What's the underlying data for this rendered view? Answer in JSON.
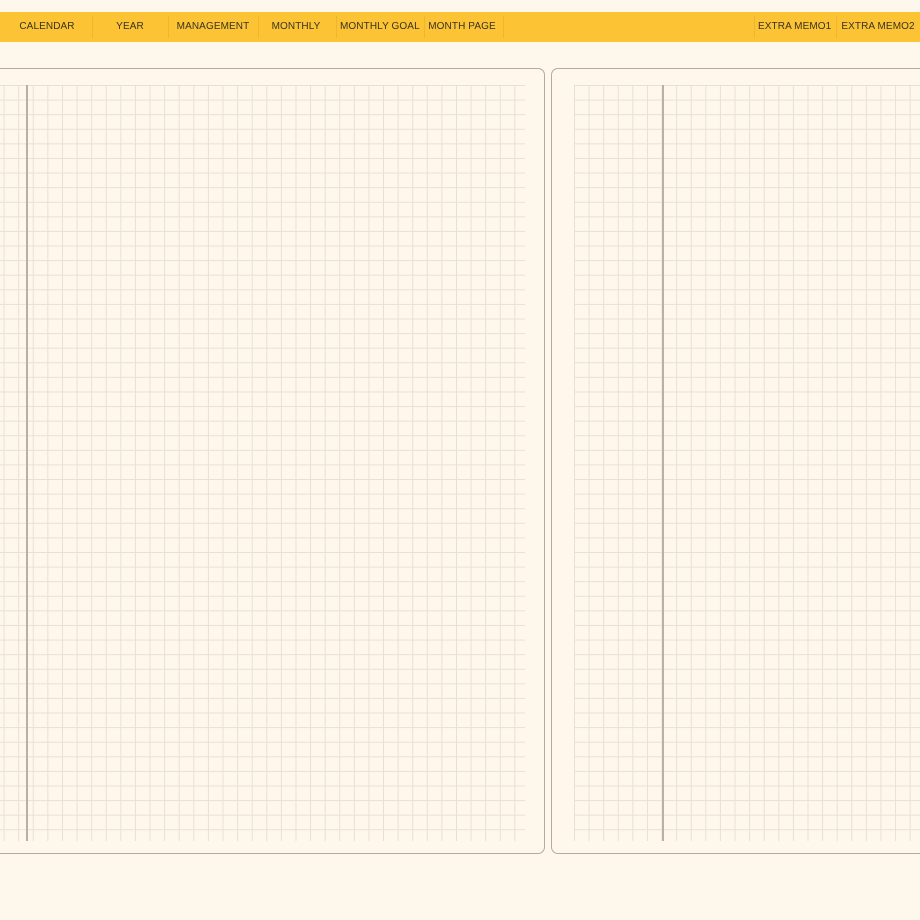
{
  "nav": {
    "items": [
      {
        "label": "CALENDAR"
      },
      {
        "label": "YEAR"
      },
      {
        "label": "MANAGEMENT"
      },
      {
        "label": "MONTHLY"
      },
      {
        "label": "MONTHLY GOAL"
      },
      {
        "label": "MONTH PAGE"
      },
      {
        "label": "EXTRA MEMO1"
      },
      {
        "label": "EXTRA MEMO2"
      }
    ]
  },
  "colors": {
    "nav_background": "#fcc334",
    "page_background": "#fef7ec",
    "panel_border": "#b5aa9b",
    "grid_line": "#e8e0d2"
  }
}
